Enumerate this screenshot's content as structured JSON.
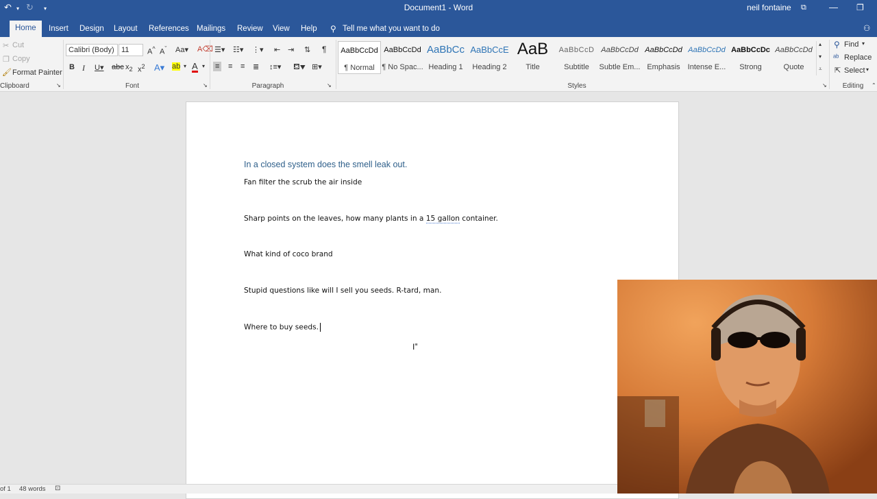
{
  "titlebar": {
    "title": "Document1  -  Word",
    "user": "neil fontaine"
  },
  "tabs": [
    "Home",
    "Insert",
    "Design",
    "Layout",
    "References",
    "Mailings",
    "Review",
    "View",
    "Help"
  ],
  "tell_me": "Tell me what you want to do",
  "clipboard": {
    "cut": "Cut",
    "copy": "Copy",
    "format_painter": "Format Painter",
    "label": "Clipboard"
  },
  "font": {
    "name": "Calibri (Body)",
    "size": "11",
    "label": "Font"
  },
  "paragraph": {
    "label": "Paragraph"
  },
  "styles": {
    "label": "Styles",
    "items": [
      {
        "sample": "AaBbCcDd",
        "name": "¶ Normal"
      },
      {
        "sample": "AaBbCcDd",
        "name": "¶ No Spac..."
      },
      {
        "sample": "AaBbCc",
        "name": "Heading 1"
      },
      {
        "sample": "AaBbCcE",
        "name": "Heading 2"
      },
      {
        "sample": "AaB",
        "name": "Title"
      },
      {
        "sample": "AaBbCcD",
        "name": "Subtitle"
      },
      {
        "sample": "AaBbCcDd",
        "name": "Subtle Em..."
      },
      {
        "sample": "AaBbCcDd",
        "name": "Emphasis"
      },
      {
        "sample": "AaBbCcDd",
        "name": "Intense E..."
      },
      {
        "sample": "AaBbCcDc",
        "name": "Strong"
      },
      {
        "sample": "AaBbCcDd",
        "name": "Quote"
      }
    ]
  },
  "editing": {
    "find": "Find",
    "replace": "Replace",
    "select": "Select",
    "label": "Editing"
  },
  "document": {
    "line1": "In a closed system does the smell leak out.",
    "line2": "Fan filter the scrub the air inside",
    "line3_a": "Sharp points on the leaves, how many plants in a ",
    "line3_b": "15 gallon",
    "line3_c": " container.",
    "line4": "What kind of coco brand",
    "line5": "Stupid questions like will I sell you seeds. R-tard, man.",
    "line6": "Where to buy seeds."
  },
  "status": {
    "page": "of 1",
    "words": "48 words"
  },
  "colors": {
    "ribbon_blue": "#2b579a",
    "heading_text": "#2e5f8a"
  }
}
